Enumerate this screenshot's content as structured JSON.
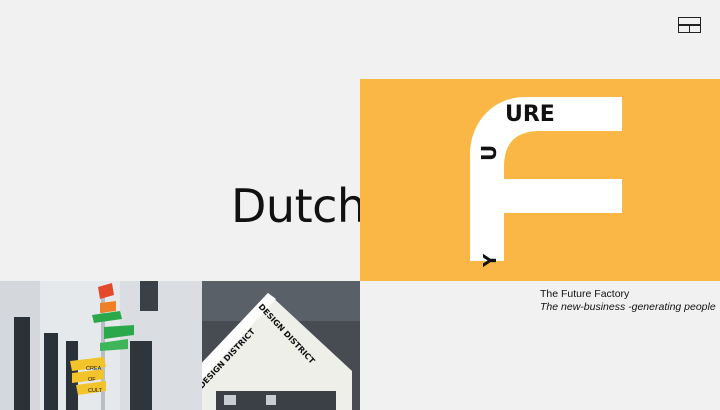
{
  "hero": {
    "word": "Dutch"
  },
  "logo": {
    "letters_top": "URE",
    "letter_side": "U",
    "letter_bottom": "Y"
  },
  "project": {
    "title": "The Future Factory",
    "subtitle": "The new-business -generating people"
  },
  "signpost": {
    "sign_1": "CREA",
    "sign_2": "OF",
    "sign_3": "CULT"
  },
  "district": {
    "label_left": "DESIGN DISTRICT",
    "label_right": "DESIGN DISTRICT"
  },
  "colors": {
    "background": "#f1f1f1",
    "accent_yellow": "#fbb746",
    "logo_white": "#ffffff"
  },
  "icons": {
    "menu": "grid-menu-icon"
  }
}
